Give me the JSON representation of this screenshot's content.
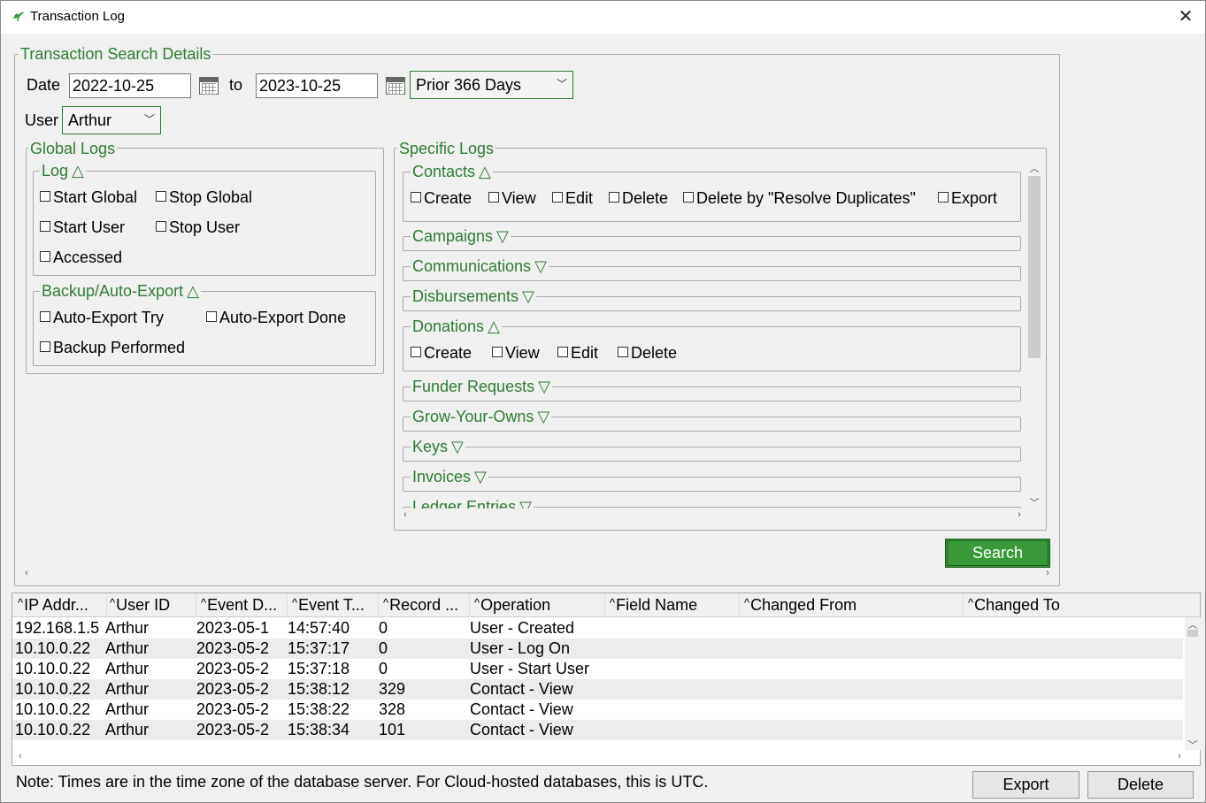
{
  "window": {
    "title": "Transaction Log",
    "close_glyph": "✕"
  },
  "search_details": {
    "legend": "Transaction Search Details",
    "date_label": "Date",
    "date_from": "2022-10-25",
    "to_label": "to",
    "date_to": "2023-10-25",
    "range_selected": "Prior 366 Days",
    "user_label": "User",
    "user_selected": "Arthur"
  },
  "global_logs": {
    "legend": "Global Logs",
    "log_group": {
      "title": "Log",
      "arrow": "△",
      "items": [
        "Start Global",
        "Stop Global",
        "Start User",
        "Stop User",
        "Accessed"
      ]
    },
    "backup_group": {
      "title": "Backup/Auto-Export",
      "arrow": "△",
      "items": [
        "Auto-Export Try",
        "Auto-Export Done",
        "Backup Performed"
      ]
    }
  },
  "specific_logs": {
    "legend": "Specific Logs",
    "contacts": {
      "title": "Contacts",
      "arrow": "△",
      "items": [
        "Create",
        "View",
        "Edit",
        "Delete",
        "Delete by \"Resolve Duplicates\"",
        "Export"
      ]
    },
    "collapsed_a": [
      {
        "title": "Campaigns",
        "arrow": "▽"
      },
      {
        "title": "Communications",
        "arrow": "▽"
      },
      {
        "title": "Disbursements",
        "arrow": "▽"
      }
    ],
    "donations": {
      "title": "Donations",
      "arrow": "△",
      "items": [
        "Create",
        "View",
        "Edit",
        "Delete"
      ]
    },
    "collapsed_b": [
      {
        "title": "Funder Requests",
        "arrow": "▽"
      },
      {
        "title": "Grow-Your-Owns",
        "arrow": "▽"
      },
      {
        "title": "Keys",
        "arrow": "▽"
      },
      {
        "title": "Invoices",
        "arrow": "▽"
      },
      {
        "title": "Ledger Entries",
        "arrow": "▽"
      }
    ]
  },
  "search_button": "Search",
  "table": {
    "sort_glyph": "^",
    "columns": [
      "IP Addr...",
      "User ID",
      "Event D...",
      "Event T...",
      "Record ...",
      "Operation",
      "Field Name",
      "Changed From",
      "Changed To"
    ],
    "rows": [
      [
        "192.168.1.5",
        "Arthur",
        "2023-05-1",
        "14:57:40",
        "0",
        "User - Created",
        "",
        "",
        ""
      ],
      [
        "10.10.0.22",
        "Arthur",
        "2023-05-2",
        "15:37:17",
        "0",
        "User - Log On",
        "",
        "",
        ""
      ],
      [
        "10.10.0.22",
        "Arthur",
        "2023-05-2",
        "15:37:18",
        "0",
        "User - Start User",
        "",
        "",
        ""
      ],
      [
        "10.10.0.22",
        "Arthur",
        "2023-05-2",
        "15:38:12",
        "329",
        "Contact - View",
        "",
        "",
        ""
      ],
      [
        "10.10.0.22",
        "Arthur",
        "2023-05-2",
        "15:38:22",
        "328",
        "Contact - View",
        "",
        "",
        ""
      ],
      [
        "10.10.0.22",
        "Arthur",
        "2023-05-2",
        "15:38:34",
        "101",
        "Contact - View",
        "",
        "",
        ""
      ]
    ]
  },
  "footer": {
    "note": "Note: Times are in the time zone of the database server. For Cloud-hosted databases, this is UTC.",
    "export_label": "Export",
    "delete_label": "Delete"
  },
  "colors": {
    "accent": "#2e7d32",
    "search_button": "#3a9a3a"
  },
  "icons": {
    "app": "sprout-icon",
    "calendar": "calendar-icon",
    "close": "close-icon",
    "dropdown": "chevron-down-icon"
  }
}
